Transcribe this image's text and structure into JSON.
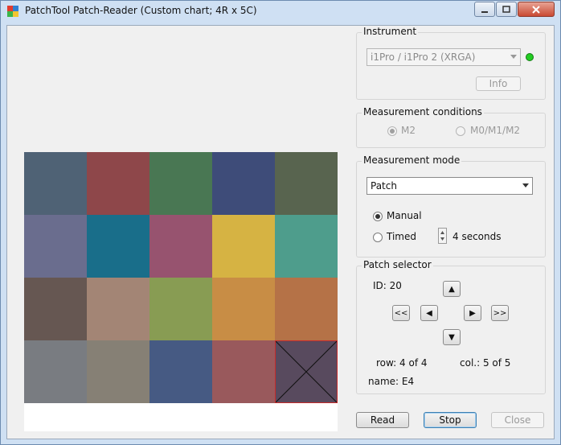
{
  "window": {
    "title": "PatchTool Patch-Reader (Custom chart; 4R x 5C)"
  },
  "chart_patches": [
    [
      "#4f6275",
      "#8e474a",
      "#497753",
      "#3e4c79",
      "#58644f"
    ],
    [
      "#6a6d8e",
      "#196e8a",
      "#97536f",
      "#d6b343",
      "#4e9d8c"
    ],
    [
      "#665752",
      "#a38575",
      "#889c53",
      "#c88d45",
      "#b57247"
    ],
    [
      "#797c81",
      "#868075",
      "#465a83",
      "#99595c",
      "#584a5e"
    ]
  ],
  "selected_patch": {
    "row": 4,
    "col": 5
  },
  "instrument": {
    "group_label": "Instrument",
    "device": "i1Pro / i1Pro 2 (XRGA)",
    "status_color": "#22cc22",
    "info_label": "Info"
  },
  "conditions": {
    "group_label": "Measurement conditions",
    "options": [
      "M2",
      "M0/M1/M2"
    ],
    "selected": "M2"
  },
  "mode": {
    "group_label": "Measurement mode",
    "select_value": "Patch",
    "manual_label": "Manual",
    "timed_label": "Timed",
    "selected": "Manual",
    "interval": "4 seconds"
  },
  "selector": {
    "group_label": "Patch selector",
    "id_text": "ID: 20",
    "up": "▲",
    "down": "▼",
    "left": "◀",
    "right": "▶",
    "first": "<<",
    "last": ">>",
    "row_text": "row:  4 of 4",
    "col_text": "col.:  5 of 5",
    "name_text": "name:  E4"
  },
  "buttons": {
    "read": "Read",
    "stop": "Stop",
    "close": "Close"
  }
}
